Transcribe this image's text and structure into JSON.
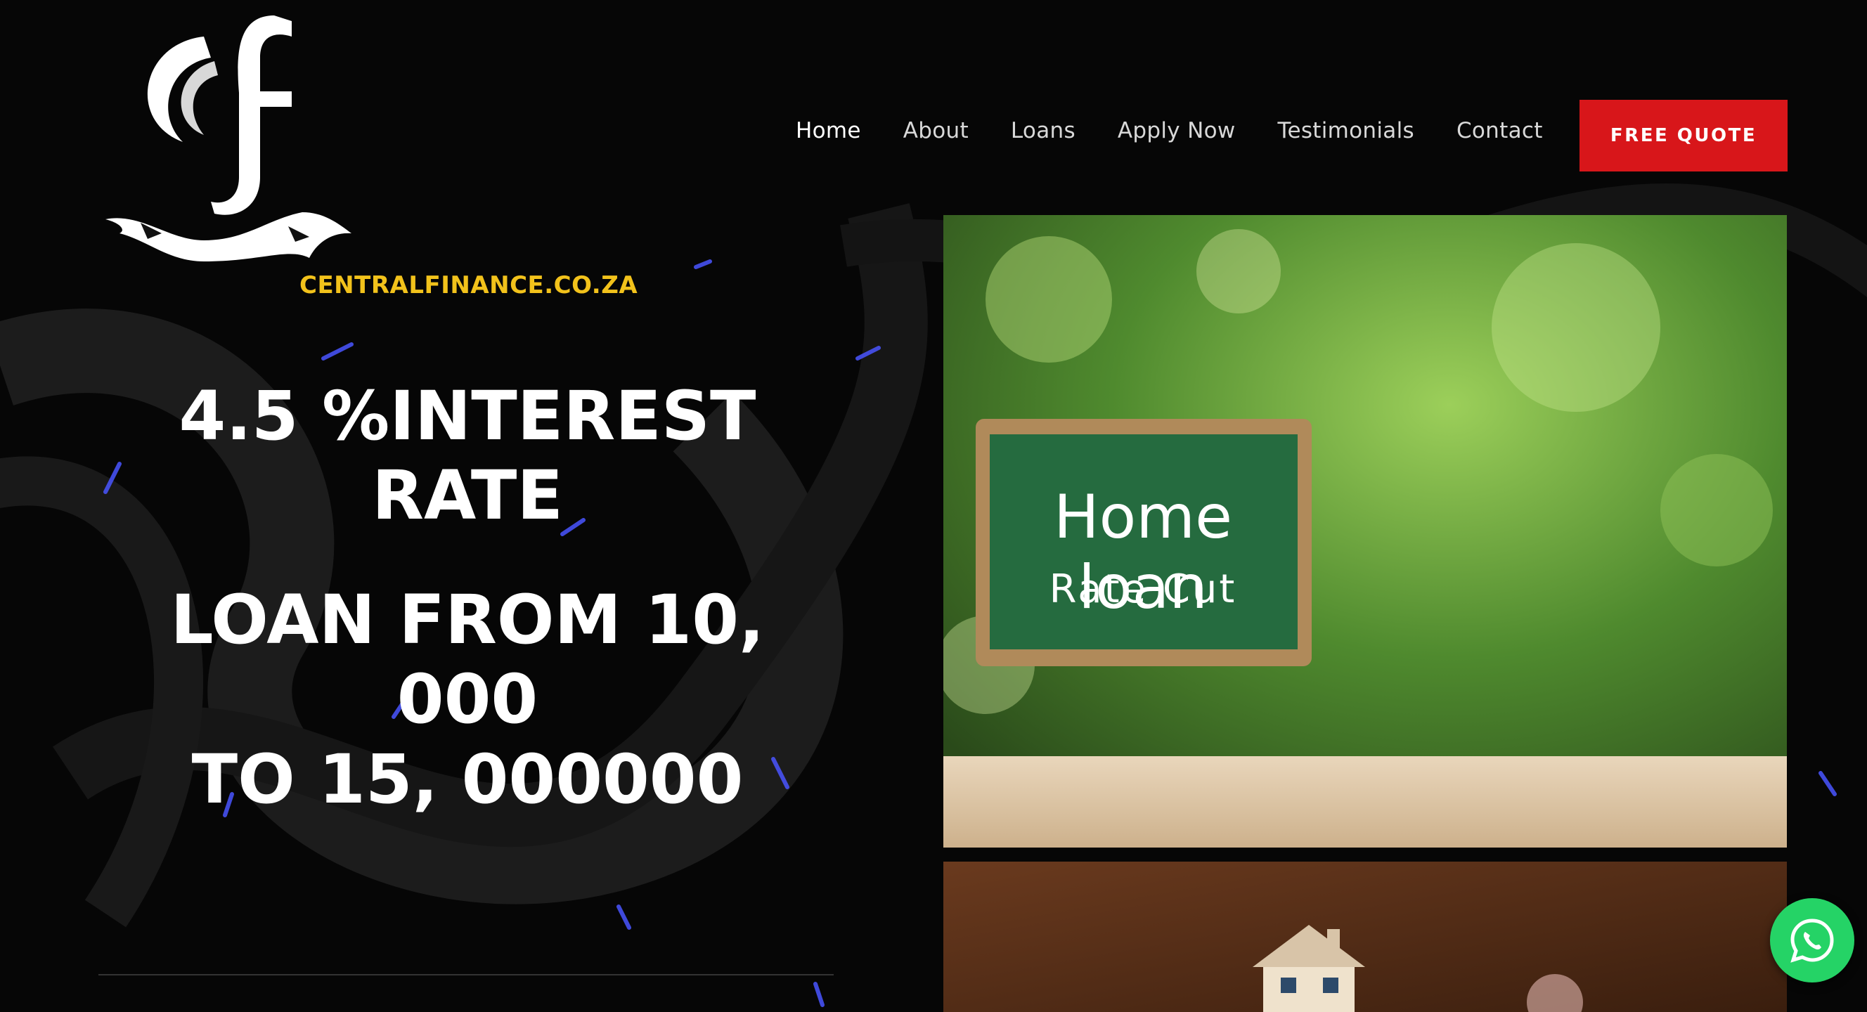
{
  "brand": {
    "domain_text": "CENTRALFINANCE.CO.ZA",
    "accent_color": "#f2c21b"
  },
  "nav": {
    "items": [
      {
        "label": "Home",
        "active": true
      },
      {
        "label": "About",
        "active": false
      },
      {
        "label": "Loans",
        "active": false
      },
      {
        "label": "Apply Now",
        "active": false
      },
      {
        "label": "Testimonials",
        "active": false
      },
      {
        "label": "Contact",
        "active": false
      }
    ],
    "cta_label": "FREE QUOTE",
    "cta_color": "#d8161a"
  },
  "hero": {
    "headline_line1": "4.5 %INTEREST",
    "headline_line2": "RATE",
    "subheadline_line1": "LOAN FROM 10, 000",
    "subheadline_line2": "TO 15, 000000"
  },
  "image1": {
    "board_title": "Home loan",
    "board_subtitle": "Rate Cut"
  },
  "floating": {
    "whatsapp_icon": "whatsapp-icon",
    "whatsapp_color": "#25d366"
  }
}
